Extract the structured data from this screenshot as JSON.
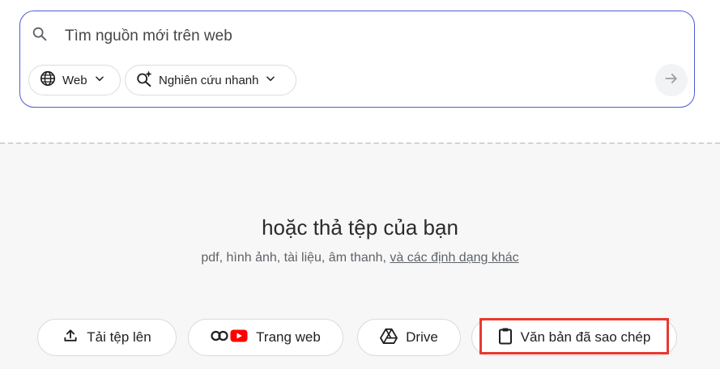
{
  "search": {
    "placeholder": "Tìm nguồn mới trên web",
    "chips": {
      "web": {
        "label": "Web",
        "icon": "globe-icon"
      },
      "research": {
        "label": "Nghiên cứu nhanh",
        "icon": "sparkle-search-icon"
      }
    },
    "submit_icon": "arrow-right-icon"
  },
  "drop_zone": {
    "title": "hoặc thả tệp của bạn",
    "subtitle_text": "pdf, hình ảnh, tài liệu, âm thanh, ",
    "subtitle_link": "và các định dạng khác"
  },
  "sources": {
    "upload": {
      "label": "Tải tệp lên",
      "icon": "upload-icon"
    },
    "website": {
      "label": "Trang web",
      "icon": "link-youtube-icon"
    },
    "drive": {
      "label": "Drive",
      "icon": "drive-icon"
    },
    "copied_text": {
      "label": "Văn bản đã sao chép",
      "icon": "clipboard-icon"
    }
  },
  "colors": {
    "search_border": "#4c5bd4",
    "drop_zone_bg": "#f7f7f7",
    "youtube_red": "#ff0000",
    "highlight": "#e8392f"
  }
}
